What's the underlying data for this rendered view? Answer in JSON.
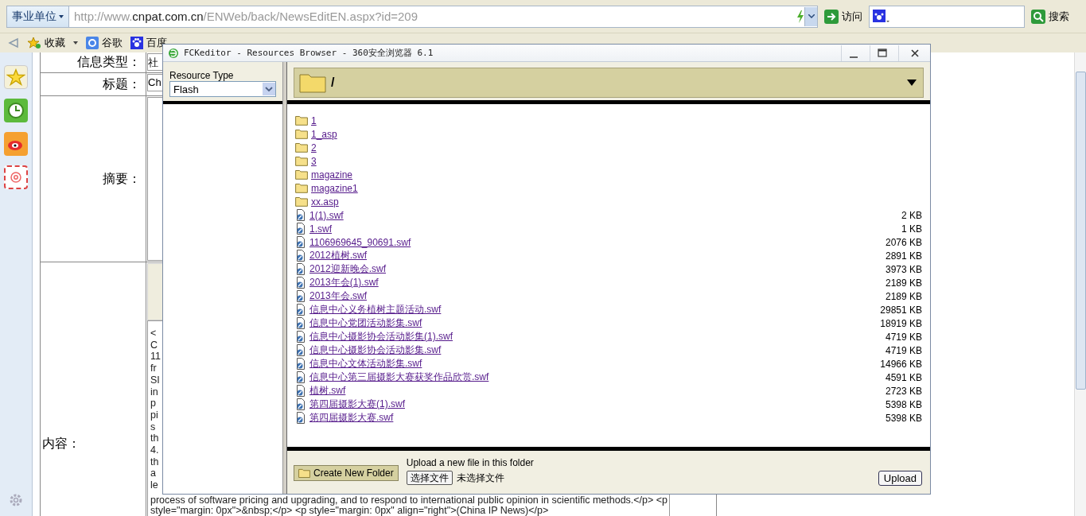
{
  "address_bar": {
    "zone": "事业单位",
    "url": {
      "scheme": "http://www.",
      "domain": "cnpat.com.cn",
      "path": "/ENWeb/back/NewsEditEN.aspx?id=209"
    },
    "go_label": "访问",
    "search_label": "搜索"
  },
  "bookmarks": [
    {
      "label": "收藏",
      "kind": "favorites"
    },
    {
      "label": "谷歌",
      "kind": "google"
    },
    {
      "label": "百度",
      "kind": "baidu"
    }
  ],
  "form": {
    "rows": [
      {
        "label": "信息类型：",
        "value": "社"
      },
      {
        "label": "标题：",
        "value": "Ch"
      },
      {
        "label": "摘要："
      },
      {
        "label": "内容："
      }
    ],
    "content_lines": [
      "<",
      "C",
      "11",
      "fr",
      "SI",
      "in",
      "p",
      "pi",
      "s",
      "th",
      "4.",
      "th",
      "a",
      "le"
    ],
    "content_full_lines": [
      "process of software pricing and upgrading, and to respond to international public opinion in scientific methods.</p> <p",
      "style=\"margin: 0px\">&nbsp;</p> <p style=\"margin: 0px\" align=\"right\">(China IP News)</p>"
    ]
  },
  "dialog": {
    "title": "FCKeditor - Resources Browser - 360安全浏览器 6.1",
    "resource_type_label": "Resource Type",
    "resource_type": "Flash",
    "current_folder": "/",
    "items": [
      {
        "name": "1",
        "kind": "folder"
      },
      {
        "name": "1_asp",
        "kind": "folder"
      },
      {
        "name": "2",
        "kind": "folder"
      },
      {
        "name": "3",
        "kind": "folder"
      },
      {
        "name": "magazine",
        "kind": "folder"
      },
      {
        "name": "magazine1",
        "kind": "folder"
      },
      {
        "name": "xx.asp",
        "kind": "folder"
      },
      {
        "name": "1(1).swf",
        "kind": "file",
        "size": "2 KB"
      },
      {
        "name": "1.swf",
        "kind": "file",
        "size": "1 KB"
      },
      {
        "name": "1106969645_90691.swf",
        "kind": "file",
        "size": "2076 KB"
      },
      {
        "name": "2012植树.swf",
        "kind": "file",
        "size": "2891 KB"
      },
      {
        "name": "2012迎新晚会.swf",
        "kind": "file",
        "size": "3973 KB"
      },
      {
        "name": "2013年会(1).swf",
        "kind": "file",
        "size": "2189 KB"
      },
      {
        "name": "2013年会.swf",
        "kind": "file",
        "size": "2189 KB"
      },
      {
        "name": "信息中心义务植树主题活动.swf",
        "kind": "file",
        "size": "29851 KB"
      },
      {
        "name": "信息中心党团活动影集.swf",
        "kind": "file",
        "size": "18919 KB"
      },
      {
        "name": "信息中心摄影协会活动影集(1).swf",
        "kind": "file",
        "size": "4719 KB"
      },
      {
        "name": "信息中心摄影协会活动影集.swf",
        "kind": "file",
        "size": "4719 KB"
      },
      {
        "name": "信息中心文体活动影集.swf",
        "kind": "file",
        "size": "14966 KB"
      },
      {
        "name": "信息中心第三届摄影大赛获奖作品欣赏.swf",
        "kind": "file",
        "size": "4591 KB"
      },
      {
        "name": "植树.swf",
        "kind": "file",
        "size": "2723 KB"
      },
      {
        "name": "第四届摄影大赛(1).swf",
        "kind": "file",
        "size": "5398 KB"
      },
      {
        "name": "第四届摄影大赛.swf",
        "kind": "file",
        "size": "5398 KB"
      }
    ],
    "create_folder_label": "Create New Folder",
    "upload_hint": "Upload a new file in this folder",
    "choose_file_label": "选择文件",
    "no_file_label": "未选择文件",
    "upload_label": "Upload"
  }
}
